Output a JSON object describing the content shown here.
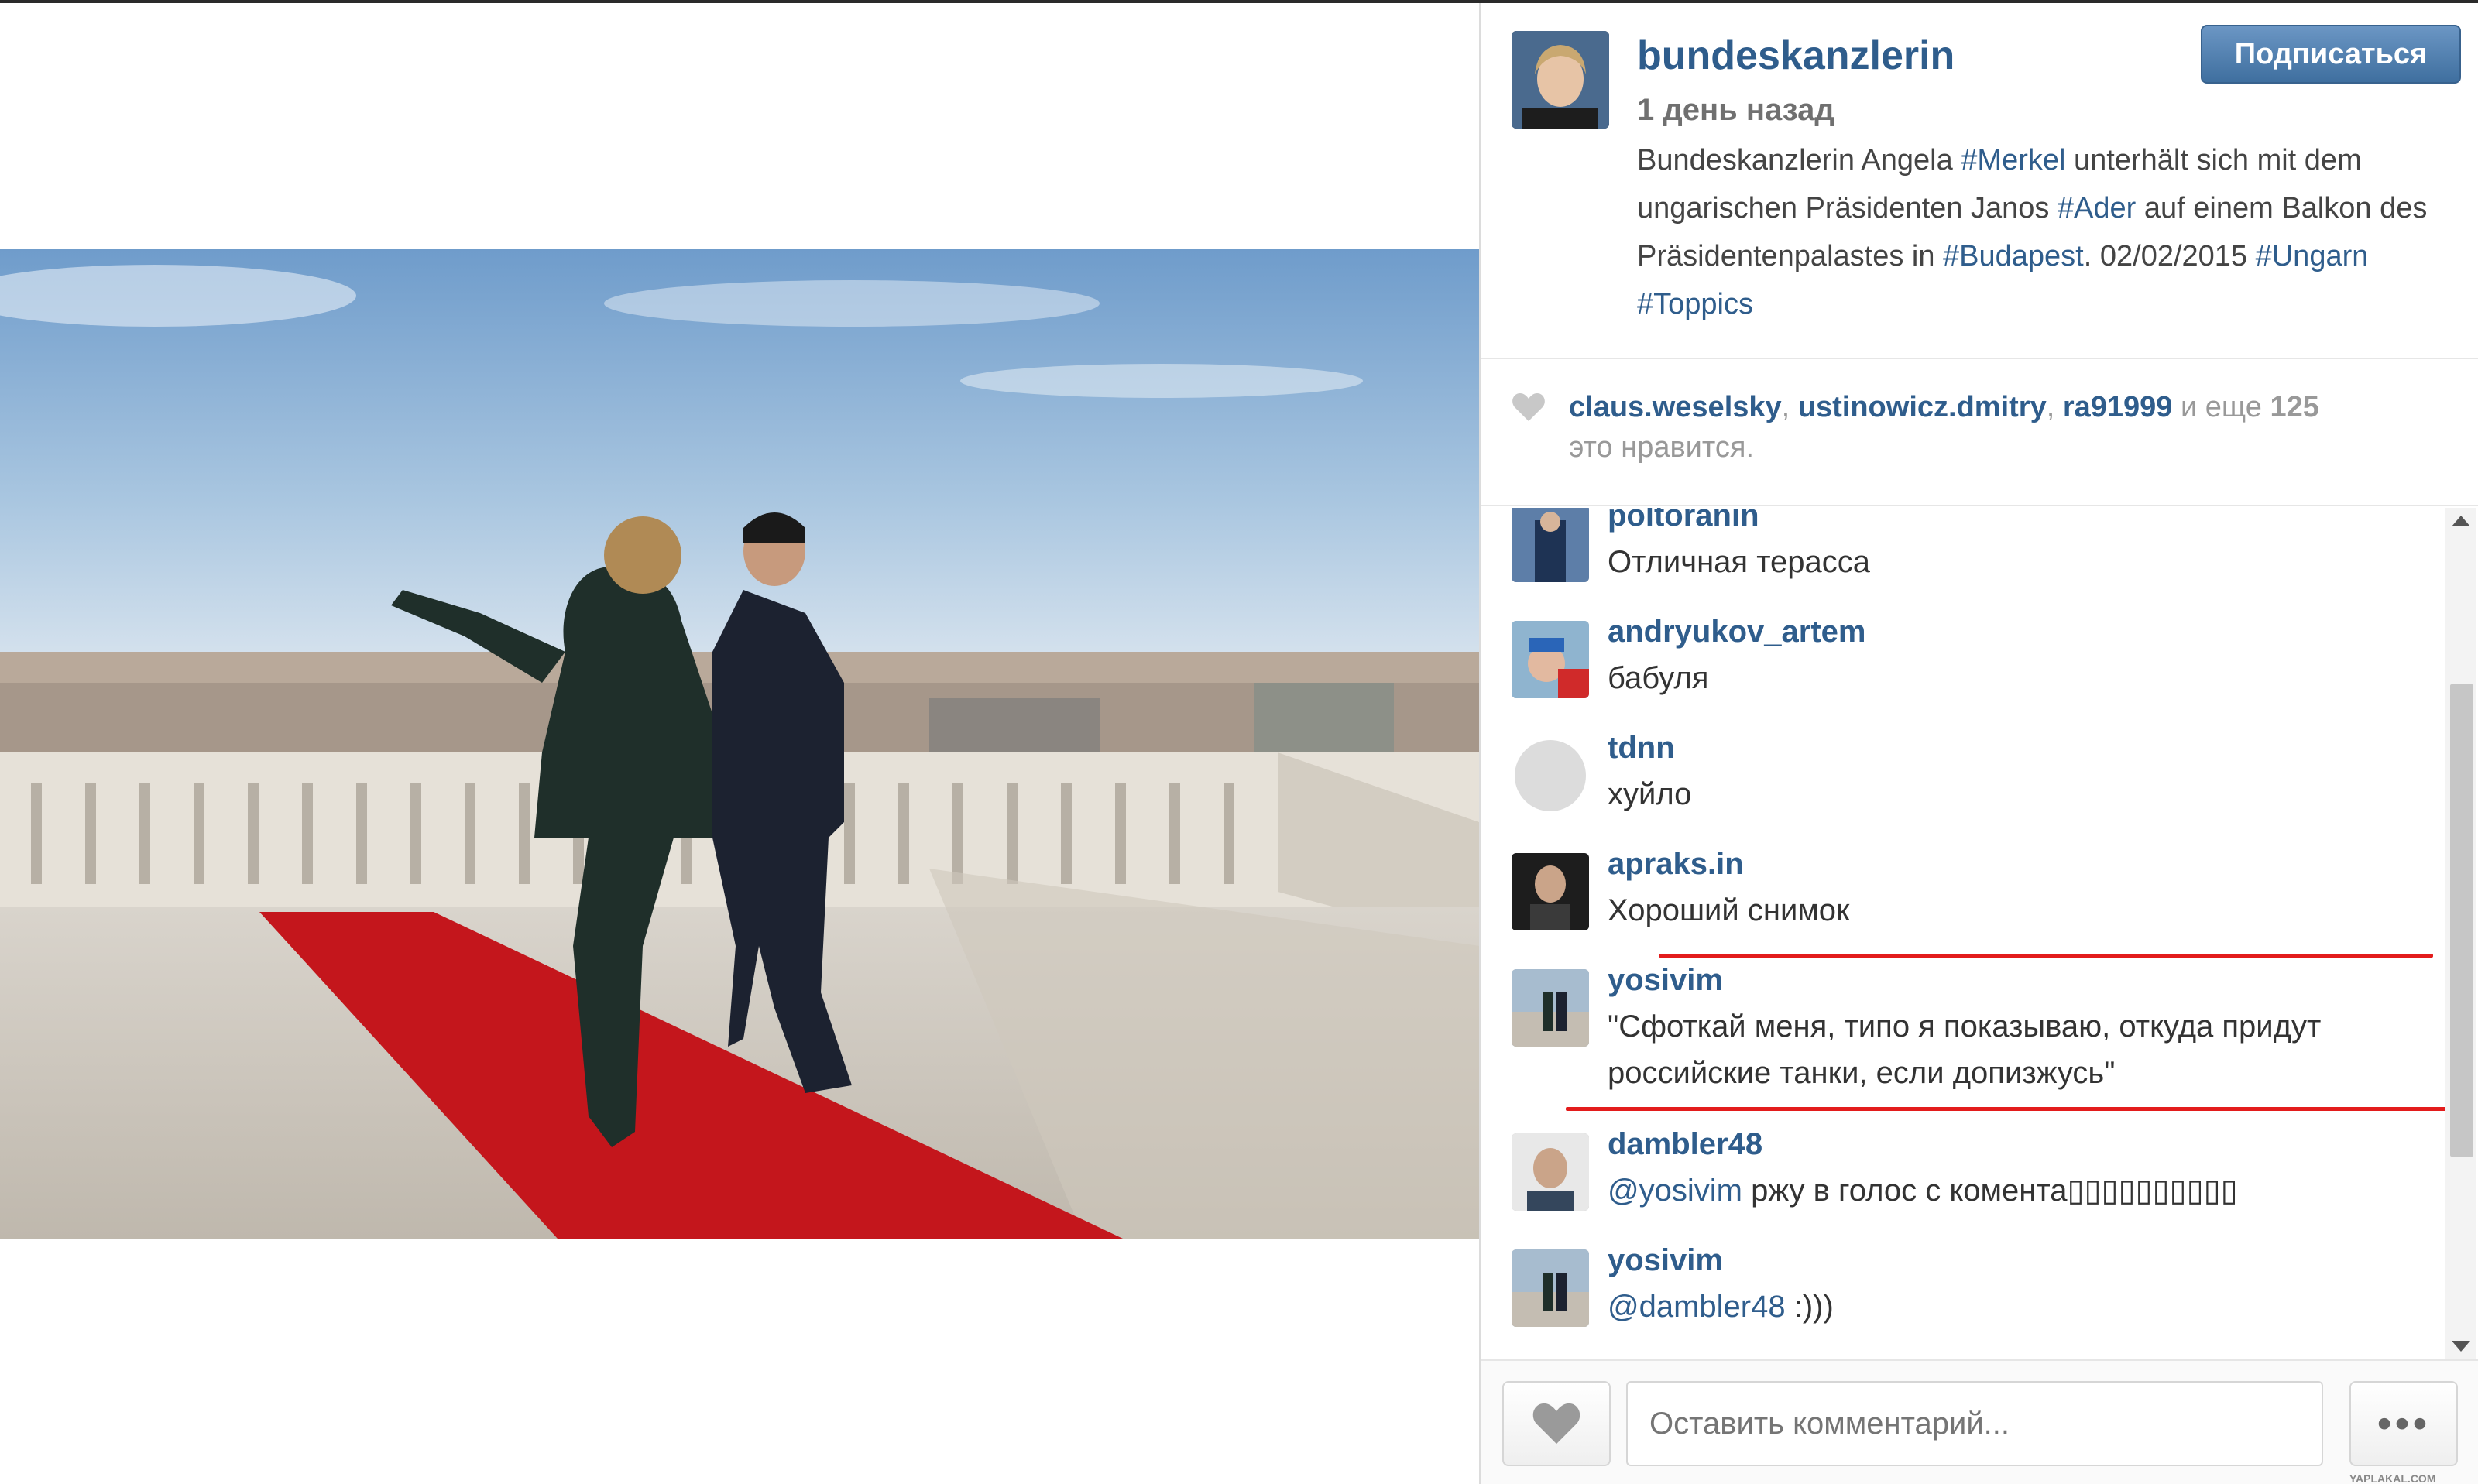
{
  "post": {
    "username": "bundeskanzlerin",
    "follow_label": "Подписаться",
    "time": "1 день назад",
    "caption": {
      "p1": "Bundeskanzlerin Angela ",
      "t1": "#Merkel",
      "p2": " unterhält sich mit dem ungarischen Präsidenten Janos ",
      "t2": "#Ader",
      "p3": " auf einem Balkon des Präsidentenpalastes in ",
      "t3": "#Budapest",
      "p4": ". 02/02/2015 ",
      "t4": "#Ungarn",
      "p5": " ",
      "t5": "#Toppics"
    }
  },
  "likes": {
    "user1": "claus.weselsky",
    "user2": "ustinowicz.dmitry",
    "user3": "ra91999",
    "more_prefix": " и еще ",
    "count": "125",
    "suffix": "это нравится."
  },
  "comments": [
    {
      "user": "poltoranin",
      "text": "Отличная терасса"
    },
    {
      "user": "andryukov_artem",
      "text": "бабуля"
    },
    {
      "user": "tdnn",
      "text": "хуйло"
    },
    {
      "user": "apraks.in",
      "text": "Хороший снимок"
    },
    {
      "user": "yosivim",
      "text": "\"Сфоткай меня, типо я показываю, откуда придут российские танки, если допизжусь\""
    },
    {
      "user": "dambler48",
      "mention": "@yosivim",
      "text": " ржу в голос с комента▯▯▯▯▯▯▯▯▯▯"
    },
    {
      "user": "yosivim",
      "mention": "@dambler48",
      "text": " :)))"
    }
  ],
  "footer": {
    "comment_placeholder": "Оставить комментарий...",
    "more_label": "•••",
    "watermark": "YAPLAKAL.COM"
  },
  "icons": {
    "like": "heart-icon",
    "more": "more-dots-icon",
    "scroll_up": "chevron-up-icon",
    "scroll_down": "chevron-down-icon"
  },
  "colors": {
    "link": "#2f5d8c",
    "follow_button": "#4a7bb0",
    "annotation_red": "#e31c1c",
    "carpet": "#c4161c"
  }
}
